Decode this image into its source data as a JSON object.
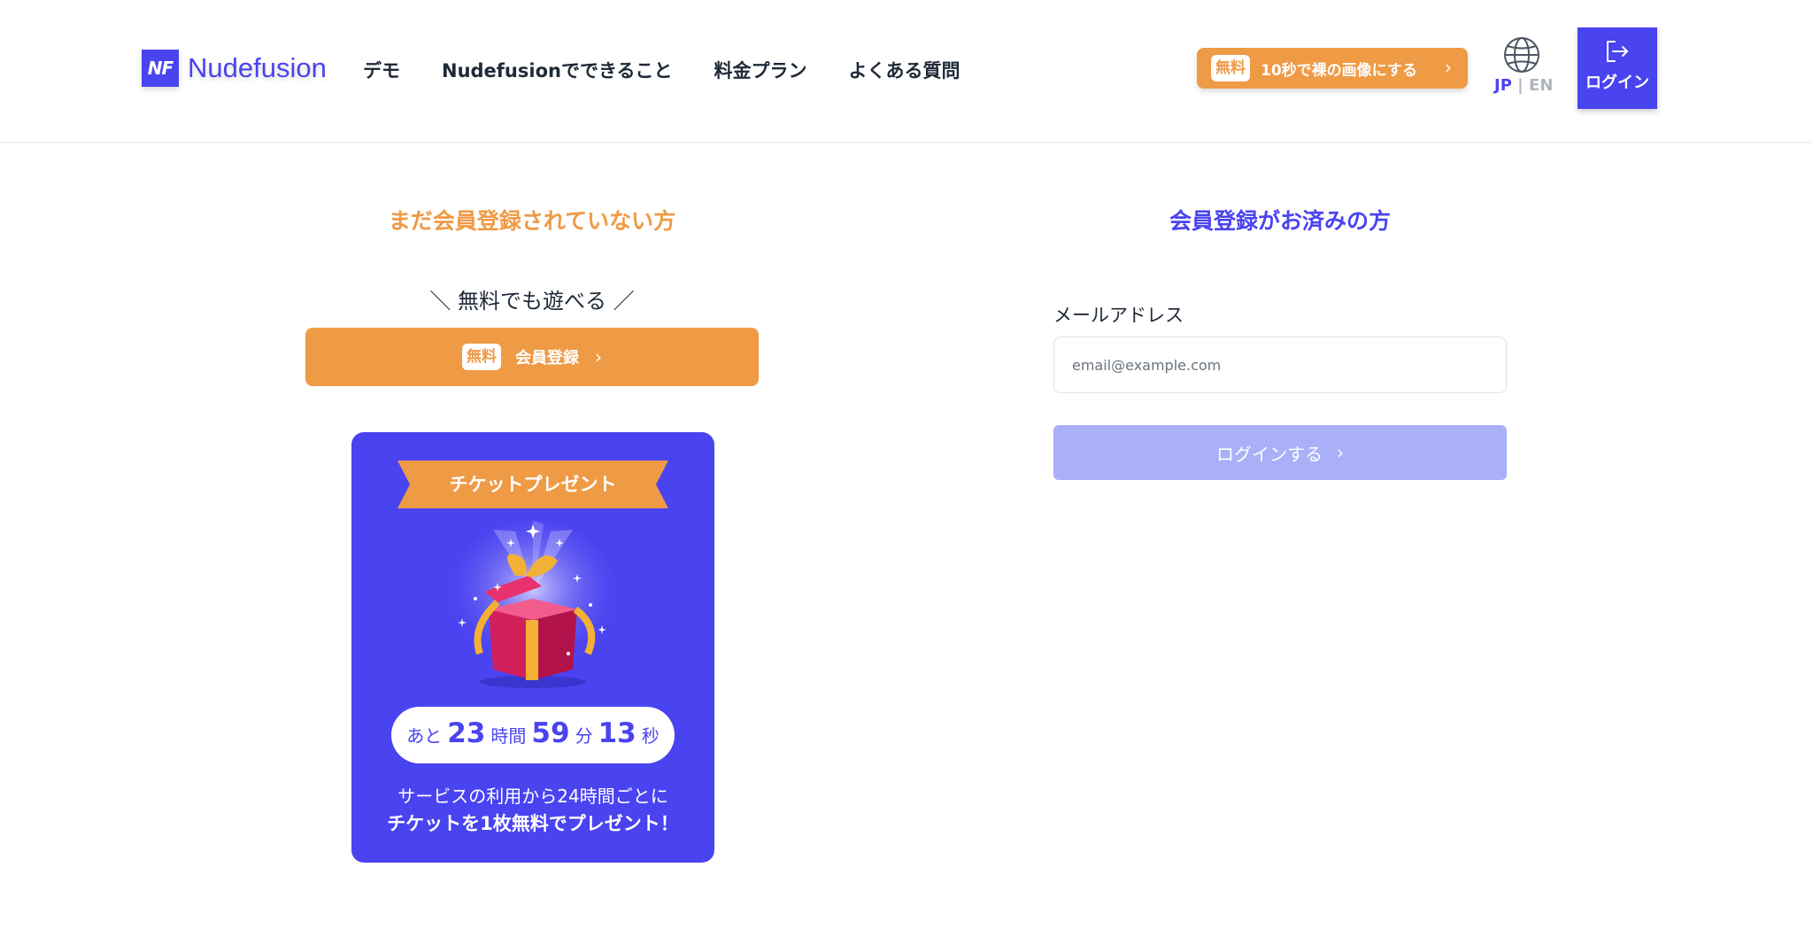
{
  "header": {
    "logo_mark": "NF",
    "logo_text": "Nudefusion",
    "nav": [
      "デモ",
      "Nudefusionでできること",
      "料金プラン",
      "よくある質問"
    ],
    "promo": {
      "tag": "無料",
      "label": "10秒で裸の画像にする",
      "chevron": "›"
    },
    "lang": {
      "jp": "JP",
      "sep": "|",
      "en": "EN"
    },
    "login_label": "ログイン"
  },
  "left": {
    "title": "まだ会員登録されていない方",
    "free_play": "＼ 無料でも遊べる ／",
    "register": {
      "tag": "無料",
      "label": "会員登録",
      "chevron": "›"
    },
    "card": {
      "ribbon": "チケットプレゼント",
      "timer": {
        "prefix": "あと",
        "hours": "23",
        "hours_unit": "時間",
        "minutes": "59",
        "minutes_unit": "分",
        "seconds": "13",
        "seconds_unit": "秒"
      },
      "line1": "サービスの利用から24時間ごとに",
      "line2": "チケットを1枚無料でプレゼント！"
    }
  },
  "right": {
    "title": "会員登録がお済みの方",
    "email_label": "メールアドレス",
    "email_placeholder": "email@example.com",
    "email_value": "",
    "submit": {
      "label": "ログインする",
      "chevron": "›"
    }
  },
  "colors": {
    "brand": "#4a43f0",
    "accent": "#ef9a45",
    "disabled": "#a9b0f7"
  },
  "icons": [
    "globe-icon",
    "login-arrow-icon",
    "gift-icon",
    "chevron-right-icon"
  ]
}
